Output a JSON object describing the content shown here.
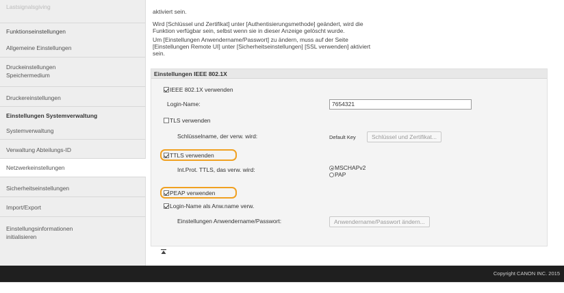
{
  "sidebar": {
    "top_faded": "Lastsignalsgiving",
    "section_function": "Funktionseinstellungen",
    "general_settings": "Allgemeine Einstellungen",
    "print_settings_line1": "Druckeinstellungen",
    "print_settings_line2": "Speichermedium",
    "printer_settings": "Druckereinstellungen",
    "system_mgmt_settings": "Einstellungen Systemverwaltung",
    "system_mgmt": "Systemverwaltung",
    "dept_id_mgmt": "Verwaltung Abteilungs-ID",
    "network_settings": "Netzwerkeinstellungen",
    "security_settings": "Sicherheitseinstellungen",
    "import_export": "Import/Export",
    "init_settings_line1": "Einstellungsinformationen",
    "init_settings_line2": "initialisieren"
  },
  "main": {
    "desc_line0": "aktiviert sein.",
    "desc_line1": "Wird [Schlüssel und Zertifikat] unter [Authentisierungsmethode] geändert, wird die",
    "desc_line2": "Funktion verfügbar sein, selbst wenn sie in dieser Anzeige gelöscht wurde.",
    "desc_line3": "Um [Einstellungen Anwendername/Passwort] zu ändern, muss auf der Seite",
    "desc_line4": "[Einstellungen Remote UI] unter [Sicherheitseinstellungen] [SSL verwenden] aktiviert",
    "desc_line5": "sein.",
    "section_title": "Einstellungen IEEE 802.1X",
    "use_ieee": "IEEE 802.1X verwenden",
    "login_name_label": "Login-Name:",
    "login_name_value": "7654321",
    "use_tls": "TLS verwenden",
    "key_name_label": "Schlüsselname, der verw. wird:",
    "default_key": "Default Key",
    "key_cert_button": "Schlüssel und Zertifikat...",
    "use_ttls": "TTLS verwenden",
    "inner_protocol_label": "Int.Prot. TTLS, das verw. wird:",
    "mschapv2": "MSCHAPv2",
    "pap": "PAP",
    "use_peap": "PEAP verwenden",
    "login_as_user": "Login-Name als Anw.name verw.",
    "user_pass_label": "Einstellungen Anwendername/Passwort:",
    "user_pass_button": "Anwendername/Passwort ändern..."
  },
  "footer": {
    "copyright": "Copyright CANON INC. 2015"
  },
  "colors": {
    "highlight": "#f0a020",
    "footer_bg": "#1f1f1f",
    "sidebar_bg": "#eeeeee"
  }
}
